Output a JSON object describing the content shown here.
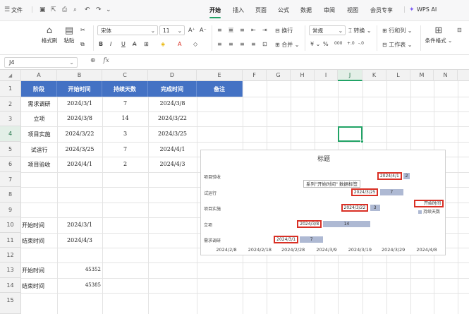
{
  "menubar": {
    "file": "文件",
    "tabs": [
      "开始",
      "插入",
      "页面",
      "公式",
      "数据",
      "审阅",
      "视图",
      "会员专享"
    ],
    "wps_ai": "WPS AI"
  },
  "ribbon": {
    "format_painter": "格式刷",
    "paste": "粘贴",
    "font_name": "宋体",
    "font_size": "11",
    "wrap": "换行",
    "merge": "合并",
    "number_format": "常规",
    "convert": "转换",
    "row_col": "行和列",
    "worksheet": "工作表",
    "cond_format": "条件格式"
  },
  "formula_bar": {
    "name_box": "J4",
    "fx": "fx"
  },
  "columns": [
    "A",
    "B",
    "C",
    "D",
    "E",
    "F",
    "G",
    "H",
    "I",
    "J",
    "K",
    "L",
    "M",
    "N"
  ],
  "selected_column": "J",
  "rows": [
    "1",
    "2",
    "3",
    "4",
    "5",
    "6",
    "7",
    "8",
    "9",
    "10",
    "11",
    "12",
    "13",
    "14",
    "15"
  ],
  "selected_row": "4",
  "table": {
    "headers": [
      "阶段",
      "开始时间",
      "持续天数",
      "完成时间",
      "备注"
    ],
    "rows": [
      [
        "需求调研",
        "2024/3/1",
        "7",
        "2024/3/8",
        ""
      ],
      [
        "立项",
        "2024/3/8",
        "14",
        "2024/3/22",
        ""
      ],
      [
        "项目实施",
        "2024/3/22",
        "3",
        "2024/3/25",
        ""
      ],
      [
        "试运行",
        "2024/3/25",
        "7",
        "2024/4/1",
        ""
      ],
      [
        "项目验收",
        "2024/4/1",
        "2",
        "2024/4/3",
        ""
      ]
    ]
  },
  "summary": {
    "start_label": "开始时间",
    "start_value": "2024/3/1",
    "end_label": "结束时间",
    "end_value": "2024/4/3",
    "start_label2": "开始时间",
    "start_serial": "45352",
    "end_label2": "结束时间",
    "end_serial": "45385"
  },
  "chart_data": {
    "type": "bar",
    "orientation": "horizontal-stacked",
    "title": "标题",
    "categories": [
      "需求调研",
      "立项",
      "项目实施",
      "试运行",
      "项目验收"
    ],
    "series": [
      {
        "name": "开始时间",
        "values": [
          "2024/3/1",
          "2024/3/8",
          "2024/3/22",
          "2024/3/25",
          "2024/4/1"
        ],
        "hidden": true
      },
      {
        "name": "持续天数",
        "values": [
          7,
          14,
          3,
          7,
          2
        ]
      }
    ],
    "x_ticks": [
      "2024/2/8",
      "2024/2/18",
      "2024/2/28",
      "2024/3/9",
      "2024/3/19",
      "2024/3/29",
      "2024/4/8"
    ],
    "xlim": [
      "2024/2/8",
      "2024/4/8"
    ],
    "legend": "right",
    "tooltip": "系列\"开始时间\" 数据标签",
    "bar_color": "#aeb9d3",
    "highlight_color": "#d93025"
  }
}
